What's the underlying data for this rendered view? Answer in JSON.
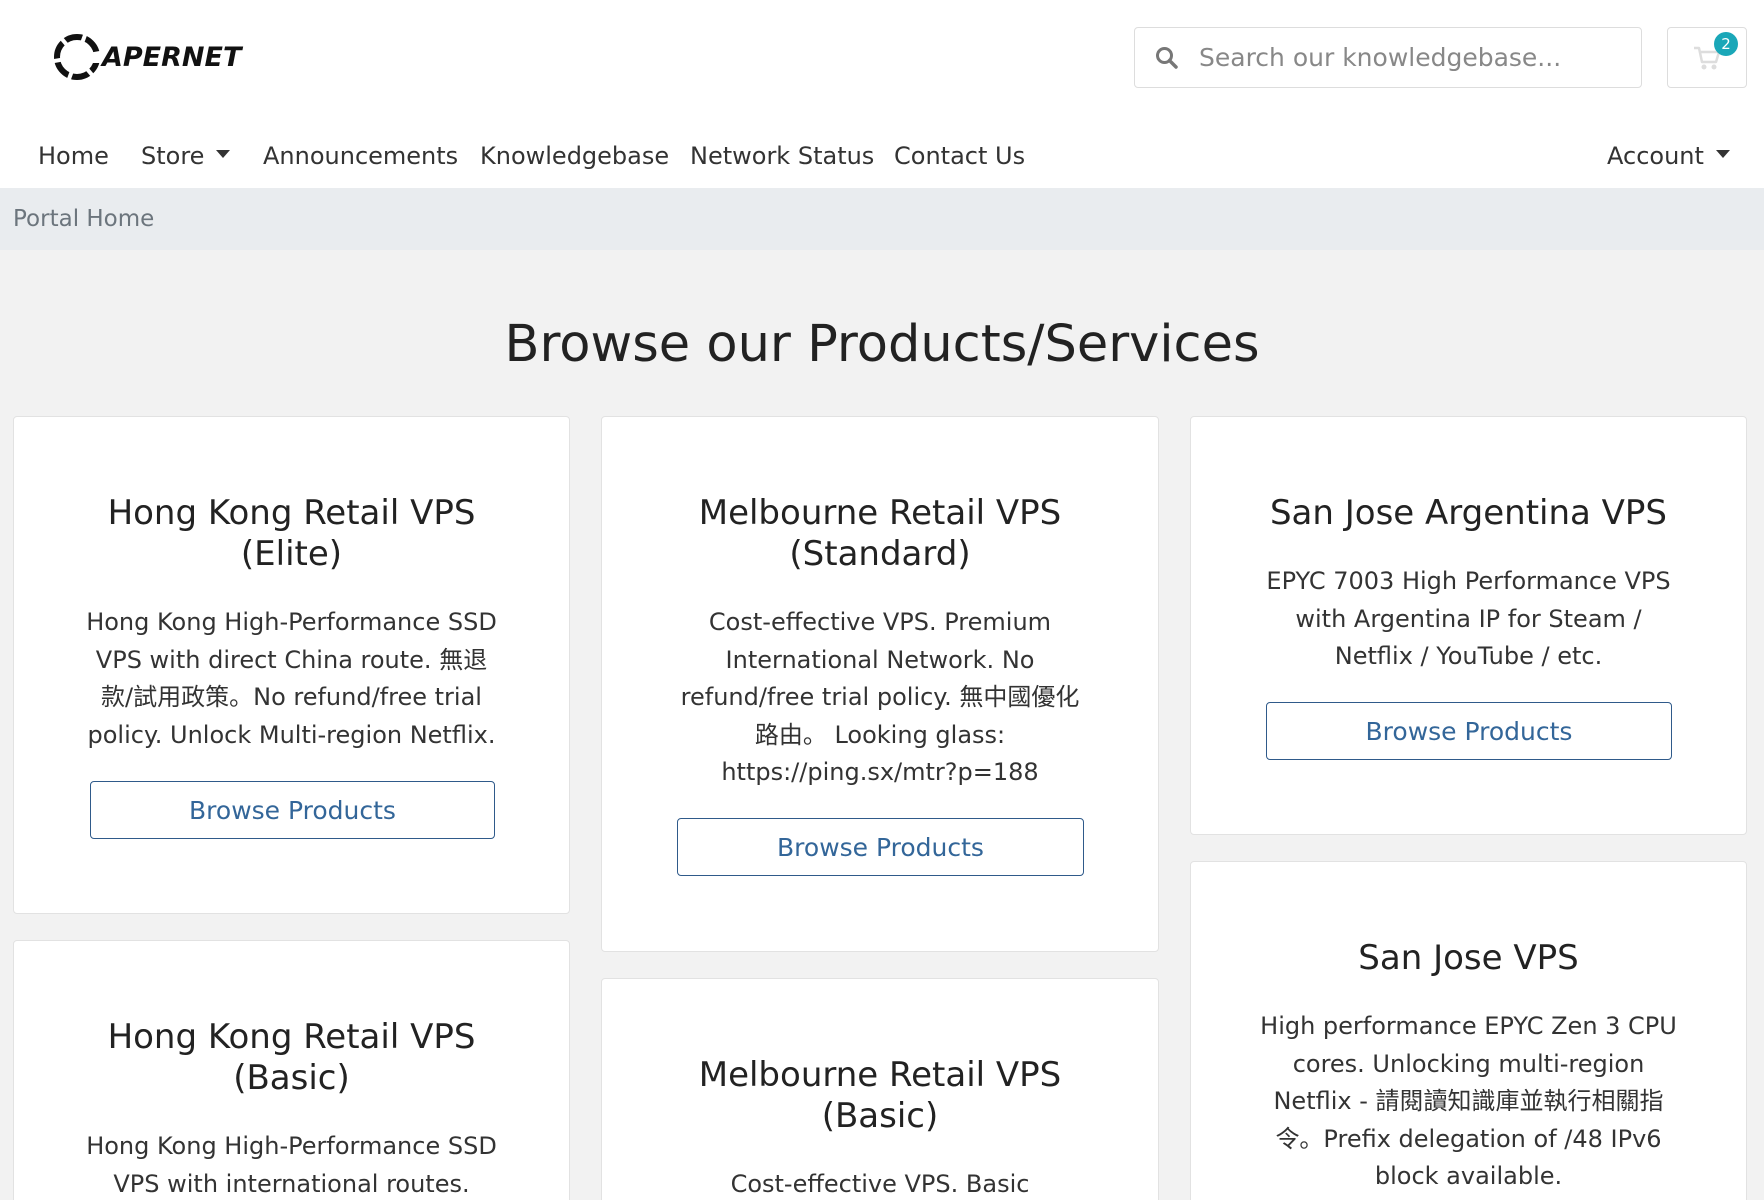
{
  "brand": {
    "logo_text": "APERNET"
  },
  "search": {
    "placeholder": "Search our knowledgebase..."
  },
  "cart": {
    "count": "2"
  },
  "nav": {
    "items": [
      "Home",
      "Store",
      "Announcements",
      "Knowledgebase",
      "Network Status",
      "Contact Us"
    ],
    "account": "Account"
  },
  "breadcrumb": {
    "current": "Portal Home"
  },
  "page": {
    "title": "Browse our Products/Services"
  },
  "products": [
    {
      "title_lines": [
        "Hong Kong Retail VPS",
        "(Elite)"
      ],
      "desc_lines": [
        "Hong Kong High-Performance SSD",
        "VPS with direct China route. 無退",
        "款/試用政策。No refund/free trial",
        "policy. Unlock Multi-region Netflix."
      ],
      "button": "Browse Products"
    },
    {
      "title_lines": [
        "Melbourne Retail VPS",
        "(Standard)"
      ],
      "desc_lines": [
        "Cost-effective VPS. Premium",
        "International Network. No",
        "refund/free trial policy. 無中國優化",
        "路由。 Looking glass:",
        "https://ping.sx/mtr?p=188"
      ],
      "button": "Browse Products"
    },
    {
      "title_lines": [
        "San Jose Argentina VPS"
      ],
      "desc_lines": [
        "EPYC 7003 High Performance VPS",
        "with Argentina IP for Steam /",
        "Netflix / YouTube / etc."
      ],
      "button": "Browse Products"
    },
    {
      "title_lines": [
        "Hong Kong Retail VPS",
        "(Basic)"
      ],
      "desc_lines": [
        "Hong Kong High-Performance SSD",
        "VPS with international routes."
      ]
    },
    {
      "title_lines": [
        "Melbourne Retail VPS",
        "(Basic)"
      ],
      "desc_lines": [
        "Cost-effective VPS. Basic"
      ]
    },
    {
      "title_lines": [
        "San Jose VPS"
      ],
      "desc_lines": [
        "High performance EPYC Zen 3 CPU",
        "cores. Unlocking multi-region",
        "Netflix - 請閱讀知識庫並執行相關指",
        "令。Prefix delegation of /48 IPv6",
        "block available."
      ]
    }
  ],
  "colors": {
    "accent": "#336699",
    "badge": "#1aa7b8",
    "breadcrumb_bg": "#e9ecef"
  }
}
